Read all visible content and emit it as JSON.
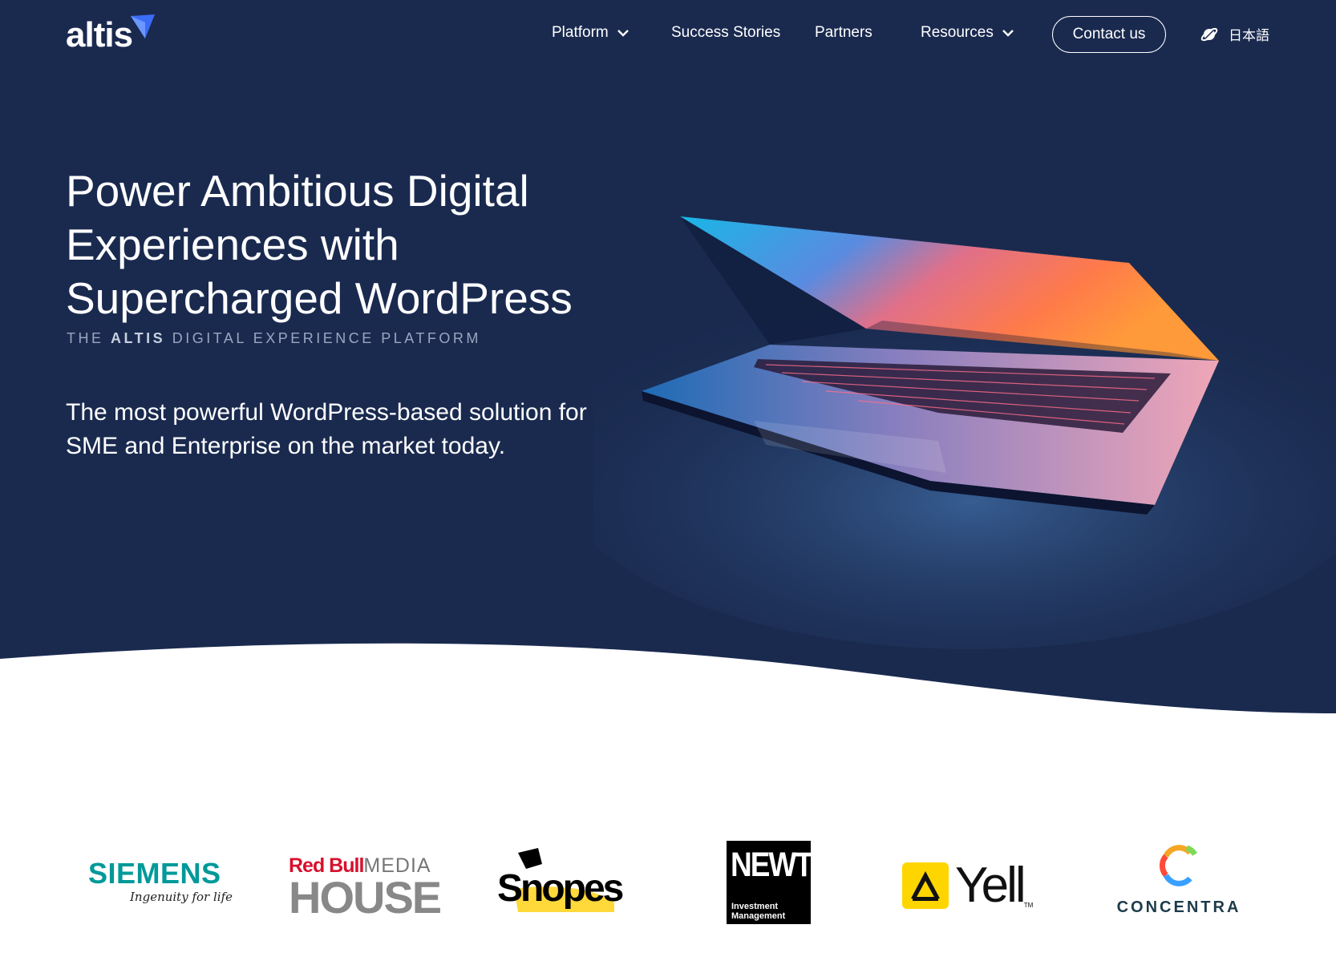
{
  "brand": {
    "logo_text": "altis"
  },
  "nav": {
    "platform": "Platform",
    "success_stories": "Success Stories",
    "partners": "Partners",
    "resources": "Resources",
    "contact": "Contact us",
    "language": "日本語"
  },
  "hero": {
    "headline": "Power Ambitious Digital Experiences with Supercharged WordPress",
    "subhead_prefix": "THE",
    "subhead_brand": "ALTIS",
    "subhead_suffix": "DIGITAL EXPERIENCE PLATFORM",
    "description": "The most powerful WordPress-based solution for SME and Enterprise on the market today."
  },
  "clients": {
    "siemens": {
      "name": "SIEMENS",
      "tagline": "Ingenuity for life"
    },
    "redbull": {
      "line1a": "Red Bull",
      "line1b": "MEDIA",
      "line2": "HOUSE"
    },
    "snopes": {
      "name": "Snopes"
    },
    "newton": {
      "name": "NEWTON",
      "sub1": "Investment",
      "sub2": "Management"
    },
    "yell": {
      "name": "Yell",
      "tm": "TM"
    },
    "concentra": {
      "name": "CONCENTRA"
    }
  },
  "colors": {
    "hero_bg": "#1a2a4f",
    "accent": "#3b6cf6",
    "siemens": "#009999",
    "redbull": "#d7102d",
    "yell": "#ffd500"
  }
}
